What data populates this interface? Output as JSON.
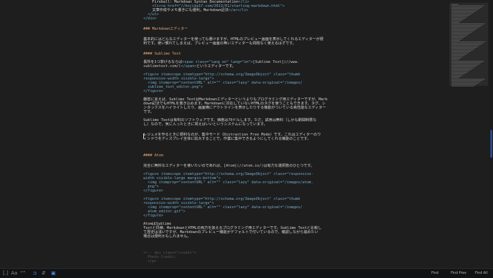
{
  "editor": {
    "lines": [
      {
        "y": 0,
        "segs": [
          [
            "    ",
            "t"
          ],
          [
            "Fireball: Markdown Syntax Documentation",
            "t"
          ],
          [
            "</li>",
            "tag"
          ]
        ]
      },
      {
        "y": 1,
        "segs": [
          [
            "    ",
            "t"
          ],
          [
            "<li><a href=\"//kojika17.com/2013/01/starting-markdown.html\">",
            "tag"
          ]
        ]
      },
      {
        "y": 2,
        "segs": [
          [
            "    ",
            "t"
          ],
          [
            "文章作成やメモ書きにも便利。Markdown記法",
            "t"
          ],
          [
            "</a></li>",
            "tag"
          ]
        ]
      },
      {
        "y": 3,
        "segs": [
          [
            "  ",
            "t"
          ],
          [
            "</ul>",
            "tag"
          ]
        ]
      },
      {
        "y": 4,
        "segs": [
          [
            "</div>",
            "tag"
          ]
        ]
      },
      {
        "y": 6.5,
        "segs": [
          [
            "### Markdownエディター",
            "head"
          ]
        ]
      },
      {
        "y": 9,
        "segs": [
          [
            "基本的にはどんなエディターを使っても書けますが、HTMLのプレビュー画面を表示してくれるエディターが便",
            "t"
          ]
        ]
      },
      {
        "y": 10,
        "segs": [
          [
            "利です。使い慣れてしまえば、プレビュー画面の無いエディターも問題なく使えるはずです。",
            "t"
          ]
        ]
      },
      {
        "y": 12.5,
        "segs": [
          [
            "#### Sublime Text",
            "head"
          ]
        ]
      },
      {
        "y": 14.5,
        "segs": [
          [
            "長所を1つ挙げるならば",
            "t"
          ],
          [
            "<span class=\"lang en\" lang=\"en\">",
            "tag"
          ],
          [
            "[Sublime Text](//www.",
            "link"
          ]
        ]
      },
      {
        "y": 15.5,
        "segs": [
          [
            "sublimetext.com/)",
            "link"
          ],
          [
            "</span>",
            "tag"
          ],
          [
            "というエディターです。",
            "t"
          ]
        ]
      },
      {
        "y": 17.5,
        "segs": [
          [
            "<figure itemscope itemtype=\"http://schema.org/ImageObject\" class=\"thumb",
            "tag"
          ]
        ]
      },
      {
        "y": 18.5,
        "segs": [
          [
            "responsive-width visible-large\">",
            "tag"
          ]
        ]
      },
      {
        "y": 19.5,
        "segs": [
          [
            "  ",
            "t"
          ],
          [
            "<img itemprop=\"contentURL\" alt=\"\" class=\"lazy\" data-original=\"/images/",
            "tag"
          ]
        ]
      },
      {
        "y": 20.5,
        "segs": [
          [
            "  ",
            "t"
          ],
          [
            "sublime_text_editor.png\">",
            "tag"
          ]
        ]
      },
      {
        "y": 21.5,
        "segs": [
          [
            "</figure>",
            "tag"
          ]
        ]
      },
      {
        "y": 23.5,
        "segs": [
          [
            "厳密に言えば、Sublime TextはMarkdownエディターというよりもプログラミング用エディターですが、Mark",
            "t"
          ]
        ]
      },
      {
        "y": 24.5,
        "segs": [
          [
            "down記法でもHTMLを書き込めます。Markdownに対応していないHTMLのタグを使うこともできます。タグ、シ",
            "t"
          ]
        ]
      },
      {
        "y": 25.5,
        "segs": [
          [
            "ンタックスをハイライトしたり、画面横にアウトラインを表示したりする機能がついている高性能なエディター",
            "t"
          ]
        ]
      },
      {
        "y": 26.5,
        "segs": [
          [
            "です。",
            "t"
          ]
        ]
      },
      {
        "y": 28.5,
        "segs": [
          [
            "Sublime Textは有料のソフトウェアです。価格は70ドルします。ただ、試用は無料（しかも期間制限な",
            "t"
          ]
        ]
      },
      {
        "y": 29.5,
        "segs": [
          [
            "し）なので、気に入ったときに買えばいいというシステムになっています。",
            "t"
          ]
        ]
      },
      {
        "y": 32,
        "segs": [
          [
            "レジュメを作るときに便利なのが、集中モード（Distraction Free Mode）です。これはエディターのウ",
            "t"
          ]
        ]
      },
      {
        "y": 33,
        "segs": [
          [
            "ィンドウをディスプレイ全体に拡大することで、作業に集中できるようにしてくれる機能のことです。",
            "t"
          ]
        ]
      },
      {
        "y": 37,
        "segs": [
          [
            "#### Atom",
            "head"
          ]
        ]
      },
      {
        "y": 39.5,
        "segs": [
          [
            "完全に無料なエディターを使いたいのであれば、",
            "t"
          ],
          [
            "[Atom](//atom.io/)",
            "link"
          ],
          [
            "は有力な選択肢のひとつです。",
            "t"
          ]
        ]
      },
      {
        "y": 41.5,
        "segs": [
          [
            "<figure itemscope itemtype=\"http://schema.org/ImageObject\" class=\"responsive-",
            "tag"
          ]
        ]
      },
      {
        "y": 42.5,
        "segs": [
          [
            "width visible-large margin-bottom\">",
            "tag"
          ]
        ]
      },
      {
        "y": 43.5,
        "segs": [
          [
            "  ",
            "t"
          ],
          [
            "<img itemprop=\"contentURL\" alt=\"\" class=\"lazy\" data-original=\"/images/atom.",
            "tag"
          ]
        ]
      },
      {
        "y": 44.5,
        "segs": [
          [
            "  ",
            "t"
          ],
          [
            "png\">",
            "tag"
          ]
        ]
      },
      {
        "y": 45.5,
        "segs": [
          [
            "</figure>",
            "tag"
          ]
        ]
      },
      {
        "y": 47.5,
        "segs": [
          [
            "<figure itemscope itemtype=\"http://schema.org/ImageObject\" class=\"thumb",
            "tag"
          ]
        ]
      },
      {
        "y": 48.5,
        "segs": [
          [
            "responsive-width visible-large\">",
            "tag"
          ]
        ]
      },
      {
        "y": 49.5,
        "segs": [
          [
            "  ",
            "t"
          ],
          [
            "<img itemprop=\"contentURL\" alt=\"\" class=\"lazy\" data-original=\"/images/",
            "tag"
          ]
        ]
      },
      {
        "y": 50.5,
        "segs": [
          [
            "  ",
            "t"
          ],
          [
            "atom_editor.gif\">",
            "tag"
          ]
        ]
      },
      {
        "y": 51.5,
        "segs": [
          [
            "</figure>",
            "tag"
          ]
        ]
      },
      {
        "y": 53.5,
        "segs": [
          [
            "AtomはSublime",
            "t"
          ]
        ]
      },
      {
        "y": 54.5,
        "segs": [
          [
            "Textと同様、MarkdownとHTMLの両方を扱えるプログラミング用エディターです。Sublime Textと比較し",
            "t"
          ]
        ]
      },
      {
        "y": 55.5,
        "segs": [
          [
            "て歴史は浅いですが、Markdownのプレビュー機能がデフォルトで付いているので、確認しながら進めたい",
            "t"
          ]
        ]
      },
      {
        "y": 56.5,
        "segs": [
          [
            "場合は便利かもしれません。",
            "t"
          ]
        ]
      },
      {
        "y": 60.5,
        "segs": [
          [
            "<!-- div class=\"credit\">",
            "cmt"
          ]
        ]
      },
      {
        "y": 61.5,
        "segs": [
          [
            "  Photo Credit:",
            "cmt"
          ]
        ]
      },
      {
        "y": 62.5,
        "segs": [
          [
            "  </p>",
            "cmt"
          ]
        ]
      }
    ]
  },
  "statusbar": {
    "icons": [
      {
        "name": "regex-toggle-icon",
        "glyph": "[.]",
        "active": false
      },
      {
        "name": "case-sensitive-icon",
        "glyph": "Aa",
        "active": false
      },
      {
        "name": "whole-word-icon",
        "glyph": "“”",
        "active": false
      },
      {
        "name": "in-selection-icon",
        "glyph": "⊐",
        "active": true
      },
      {
        "name": "wrap-icon",
        "glyph": "⇵",
        "active": false
      },
      {
        "name": "highlight-matches-icon",
        "glyph": "▣",
        "active": true
      }
    ],
    "find_label": "Find",
    "find_prev_label": "Find Prev",
    "find_all_label": "Find All"
  },
  "colors": {
    "background": "#1e1e1e",
    "text": "#d8d8d8",
    "tag": "#74aecf",
    "heading": "#e6a572",
    "accent": "#4a8be0"
  }
}
